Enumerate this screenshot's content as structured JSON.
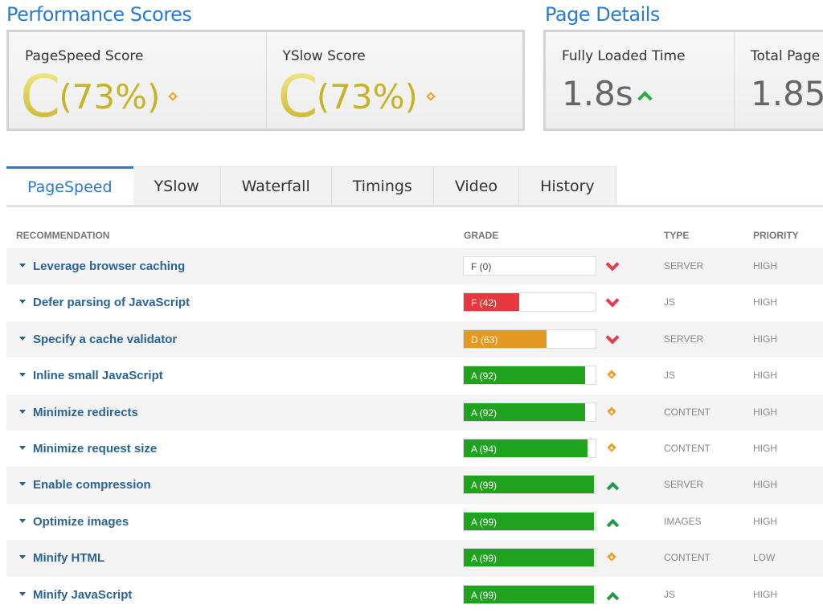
{
  "performance": {
    "title": "Performance Scores",
    "scores": [
      {
        "label": "PageSpeed Score",
        "grade": "C",
        "percent": "(73%)"
      },
      {
        "label": "YSlow Score",
        "grade": "C",
        "percent": "(73%)"
      }
    ]
  },
  "details": {
    "title": "Page Details",
    "items": [
      {
        "label": "Fully Loaded Time",
        "value": "1.8s"
      },
      {
        "label": "Total Page",
        "value": "1.85"
      }
    ]
  },
  "tabs": [
    "PageSpeed",
    "YSlow",
    "Waterfall",
    "Timings",
    "Video",
    "History"
  ],
  "table": {
    "headers": {
      "recommendation": "RECOMMENDATION",
      "grade": "GRADE",
      "type": "TYPE",
      "priority": "PRIORITY"
    },
    "rows": [
      {
        "label": "Leverage browser caching",
        "grade": "F (0)",
        "score": 0,
        "color": "#ffffff",
        "status": "down",
        "type": "SERVER",
        "priority": "HIGH"
      },
      {
        "label": "Defer parsing of JavaScript",
        "grade": "F (42)",
        "score": 42,
        "color": "#e8373e",
        "status": "down",
        "type": "JS",
        "priority": "HIGH"
      },
      {
        "label": "Specify a cache validator",
        "grade": "D (63)",
        "score": 63,
        "color": "#e49a22",
        "status": "down",
        "type": "SERVER",
        "priority": "HIGH"
      },
      {
        "label": "Inline small JavaScript",
        "grade": "A (92)",
        "score": 92,
        "color": "#1fa31f",
        "status": "neutral",
        "type": "JS",
        "priority": "HIGH"
      },
      {
        "label": "Minimize redirects",
        "grade": "A (92)",
        "score": 92,
        "color": "#1fa31f",
        "status": "neutral",
        "type": "CONTENT",
        "priority": "HIGH"
      },
      {
        "label": "Minimize request size",
        "grade": "A (94)",
        "score": 94,
        "color": "#1fa31f",
        "status": "neutral",
        "type": "CONTENT",
        "priority": "HIGH"
      },
      {
        "label": "Enable compression",
        "grade": "A (99)",
        "score": 99,
        "color": "#1fa31f",
        "status": "up",
        "type": "SERVER",
        "priority": "HIGH"
      },
      {
        "label": "Optimize images",
        "grade": "A (99)",
        "score": 99,
        "color": "#1fa31f",
        "status": "up",
        "type": "IMAGES",
        "priority": "HIGH"
      },
      {
        "label": "Minify HTML",
        "grade": "A (99)",
        "score": 99,
        "color": "#1fa31f",
        "status": "neutral",
        "type": "CONTENT",
        "priority": "LOW"
      },
      {
        "label": "Minify JavaScript",
        "grade": "A (99)",
        "score": 99,
        "color": "#1fa31f",
        "status": "up",
        "type": "JS",
        "priority": "HIGH"
      }
    ]
  }
}
